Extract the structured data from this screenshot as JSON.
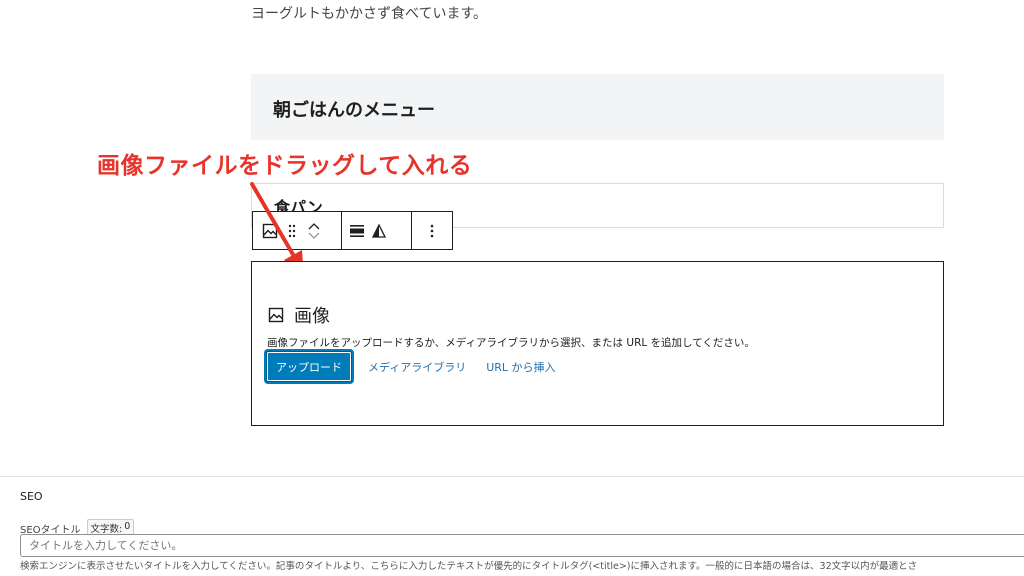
{
  "editor": {
    "paragraph_text": "ヨーグルトもかかさず食べています。",
    "heading_text": "朝ごはんのメニュー",
    "list_item_text": "食パン"
  },
  "annotation": {
    "text": "画像ファイルをドラッグして入れる",
    "color": "#e8332a"
  },
  "block_toolbar": {
    "icons": [
      "image-block-icon",
      "drag-handle-icon",
      "move-up-icon",
      "move-down-icon",
      "align-icon",
      "contrast-icon",
      "more-options-icon"
    ]
  },
  "image_block": {
    "title": "画像",
    "instructions": "画像ファイルをアップロードするか、メディアライブラリから選択、または URL を追加してください。",
    "upload_label": "アップロード",
    "media_library_label": "メディアライブラリ",
    "insert_url_label": "URL から挿入",
    "accent_color": "#007cba"
  },
  "seo": {
    "heading": "SEO",
    "title_label": "SEOタイトル",
    "char_count_label": "文字数:",
    "char_count_value": "0",
    "title_placeholder": "タイトルを入力してください。",
    "help_text": "検索エンジンに表示させたいタイトルを入力してください。記事のタイトルより、こちらに入力したテキストが優先的にタイトルタグ(<title>)に挿入されます。一般的に日本語の場合は、32文字以内が最適とさ"
  }
}
